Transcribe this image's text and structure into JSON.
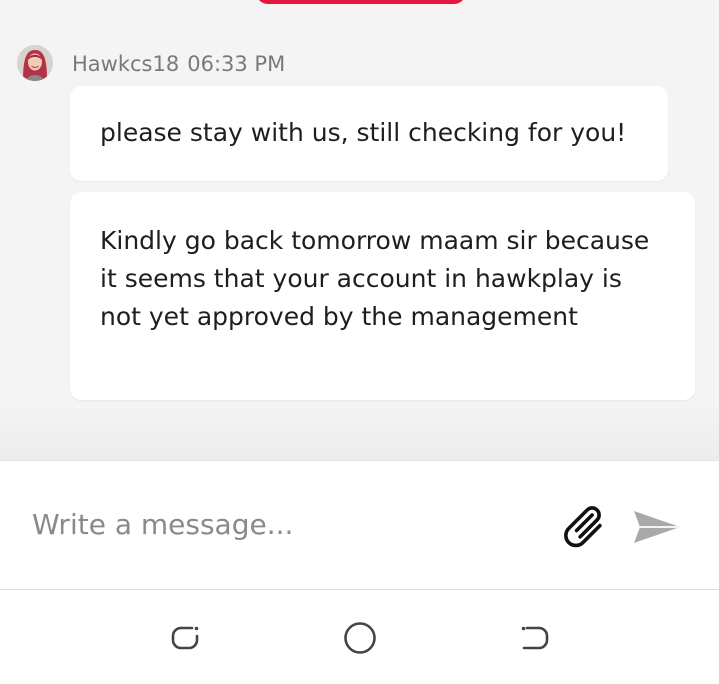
{
  "message_group": {
    "sender": "Hawkcs18",
    "time": "06:33 PM",
    "messages": [
      {
        "text": "please stay with us, still checking for you!"
      },
      {
        "text": "Kindly go back tomorrow maam sir because it seems that your account in hawkplay is not yet approved by the management"
      }
    ]
  },
  "composer": {
    "placeholder": "Write a message...",
    "attach_icon": "paperclip-icon",
    "send_icon": "send-arrow-icon"
  },
  "nav": {
    "recents_icon": "recent-apps-icon",
    "home_icon": "home-circle-icon",
    "back_icon": "back-icon"
  },
  "colors": {
    "accent": "#e5173f",
    "chat_background": "#f4f4f5",
    "bubble": "#ffffff",
    "meta_text": "#7a7a7a"
  }
}
